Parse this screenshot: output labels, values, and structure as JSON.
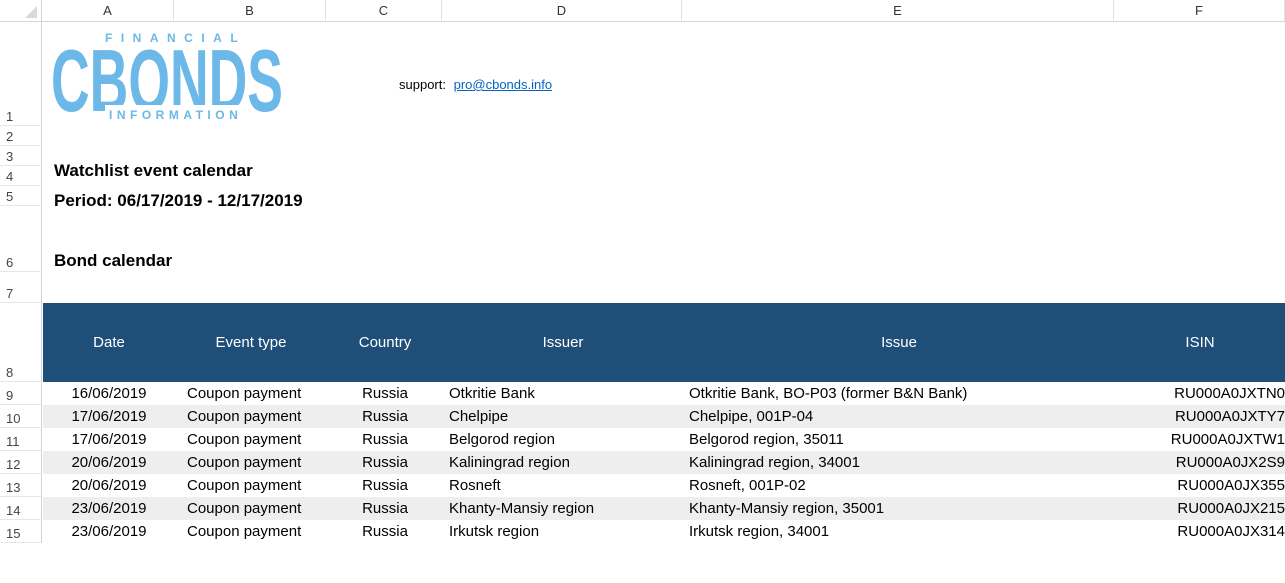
{
  "columns": [
    "A",
    "B",
    "C",
    "D",
    "E",
    "F"
  ],
  "row_numbers": [
    "1",
    "2",
    "3",
    "4",
    "5",
    "6",
    "7",
    "8",
    "9",
    "10",
    "11",
    "12",
    "13",
    "14",
    "15"
  ],
  "logo": {
    "top_text": "FINANCIAL",
    "main_text": "CBONDS",
    "bottom_text": "INFORMATION",
    "color": "#6cb8e8"
  },
  "support": {
    "label": "support:",
    "email": "pro@cbonds.info"
  },
  "title": "Watchlist event calendar",
  "period": "Period: 06/17/2019 - 12/17/2019",
  "section": "Bond calendar",
  "table": {
    "header_color": "#1f4e79",
    "headers": [
      "Date",
      "Event type",
      "Country",
      "Issuer",
      "Issue",
      "ISIN"
    ],
    "rows": [
      [
        "16/06/2019",
        "Coupon payment",
        "Russia",
        "Otkritie Bank",
        "Otkritie Bank, BO-P03 (former B&N Bank)",
        "RU000A0JXTN0"
      ],
      [
        "17/06/2019",
        "Coupon payment",
        "Russia",
        "Chelpipe",
        "Chelpipe, 001P-04",
        "RU000A0JXTY7"
      ],
      [
        "17/06/2019",
        "Coupon payment",
        "Russia",
        "Belgorod region",
        "Belgorod region, 35011",
        "RU000A0JXTW1"
      ],
      [
        "20/06/2019",
        "Coupon payment",
        "Russia",
        "Kaliningrad region",
        "Kaliningrad region, 34001",
        "RU000A0JX2S9"
      ],
      [
        "20/06/2019",
        "Coupon payment",
        "Russia",
        "Rosneft",
        "Rosneft, 001P-02",
        "RU000A0JX355"
      ],
      [
        "23/06/2019",
        "Coupon payment",
        "Russia",
        "Khanty-Mansiy region",
        "Khanty-Mansiy region, 35001",
        "RU000A0JX215"
      ],
      [
        "23/06/2019",
        "Coupon payment",
        "Russia",
        "Irkutsk region",
        "Irkutsk region, 34001",
        "RU000A0JX314"
      ]
    ]
  }
}
